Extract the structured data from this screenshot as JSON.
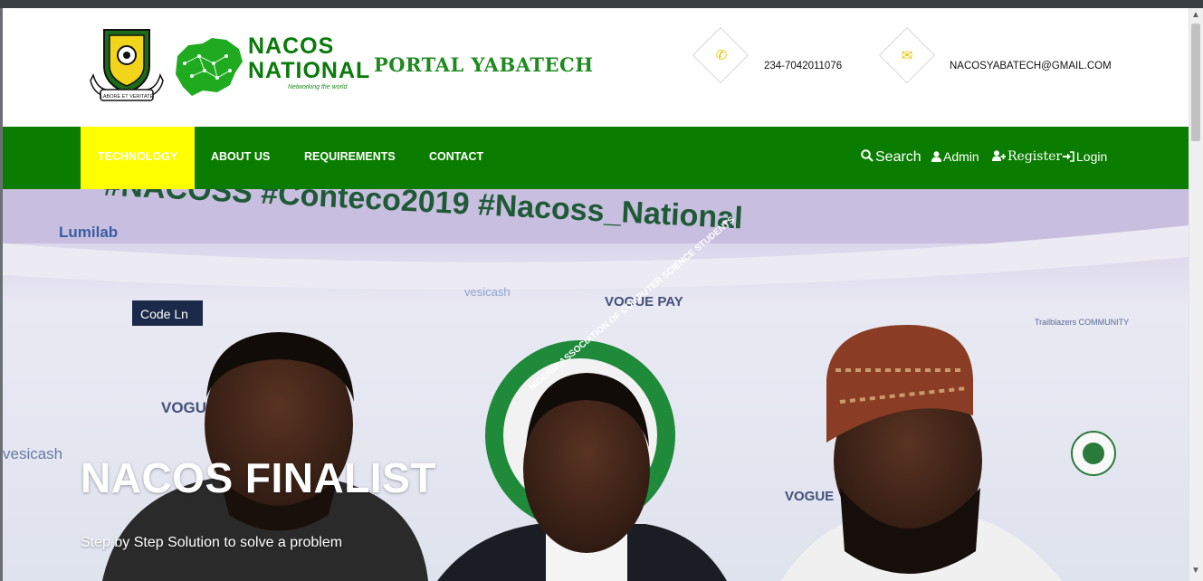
{
  "header": {
    "logo_title": "NACOS NATIONAL",
    "logo_tagline": "Networking the world",
    "portal_title": "PORTAL YABATECH",
    "crest_motto": "LABORE ET VERITATE",
    "phone": "234-7042011076",
    "email": "NACOSYABATECH@GMAIL.COM",
    "phone_icon": "phone-icon",
    "email_icon": "envelope-icon"
  },
  "nav": {
    "items": [
      {
        "label": "TECHNOLOGY",
        "active": true
      },
      {
        "label": "ABOUT US"
      },
      {
        "label": "REQUIREMENTS"
      },
      {
        "label": "CONTACT"
      }
    ],
    "right": {
      "search": "Search",
      "admin": "Admin",
      "register": "Register",
      "login": "Login"
    }
  },
  "hero": {
    "banner_text": "#NACOSS #Conteco2019 #Nacoss_National",
    "sponsors": [
      "Lumilab",
      "Code Ln",
      "vesicash",
      "VOGUE PAY",
      "VOGUE",
      "Trailblazers COMMUNITY"
    ],
    "badge_text": "NIGERIA ASSOCIATION OF COMPUTER SCIENCE STUDENTS",
    "title": "NACOS FINALIST",
    "subtitle": "Step by Step Solution to solve a problem"
  },
  "colors": {
    "nav_green": "#0a7d00",
    "active_yellow": "#ffff00",
    "brand_green": "#0a7a0a",
    "icon_yellow": "#e6c300"
  }
}
